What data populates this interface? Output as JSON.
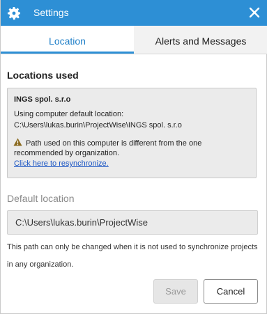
{
  "window": {
    "title": "Settings",
    "icon": "gear-icon",
    "close_icon": "close-icon",
    "accent_color": "#2d8fd5"
  },
  "tabs": [
    {
      "label": "Location",
      "active": true
    },
    {
      "label": "Alerts and Messages",
      "active": false
    }
  ],
  "locations_used": {
    "heading": "Locations used",
    "organization": "INGS spol. s.r.o",
    "using_label": "Using computer default location:",
    "path": "C:\\Users\\lukas.burin\\ProjectWise\\INGS spol. s.r.o",
    "warning_icon": "warning-icon",
    "warning_text": "Path used on this computer is different from the one recommended by organization.",
    "resync_link": "Click here to resynchronize."
  },
  "default_location": {
    "heading": "Default location",
    "value": "C:\\Users\\lukas.burin\\ProjectWise",
    "help_text": "This path can only be changed when it is not used to synchronize projects in any organization."
  },
  "buttons": {
    "save": "Save",
    "save_enabled": false,
    "cancel": "Cancel"
  }
}
